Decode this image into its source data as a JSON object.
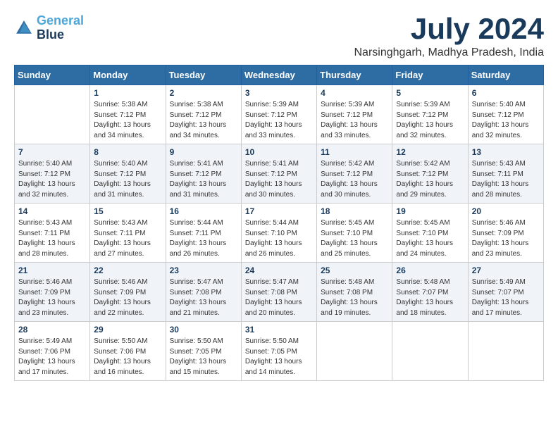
{
  "logo": {
    "line1": "General",
    "line2": "Blue"
  },
  "title": "July 2024",
  "location": "Narsinghgarh, Madhya Pradesh, India",
  "days_of_week": [
    "Sunday",
    "Monday",
    "Tuesday",
    "Wednesday",
    "Thursday",
    "Friday",
    "Saturday"
  ],
  "weeks": [
    [
      {
        "day": "",
        "sunrise": "",
        "sunset": "",
        "daylight": ""
      },
      {
        "day": "1",
        "sunrise": "Sunrise: 5:38 AM",
        "sunset": "Sunset: 7:12 PM",
        "daylight": "Daylight: 13 hours and 34 minutes."
      },
      {
        "day": "2",
        "sunrise": "Sunrise: 5:38 AM",
        "sunset": "Sunset: 7:12 PM",
        "daylight": "Daylight: 13 hours and 34 minutes."
      },
      {
        "day": "3",
        "sunrise": "Sunrise: 5:39 AM",
        "sunset": "Sunset: 7:12 PM",
        "daylight": "Daylight: 13 hours and 33 minutes."
      },
      {
        "day": "4",
        "sunrise": "Sunrise: 5:39 AM",
        "sunset": "Sunset: 7:12 PM",
        "daylight": "Daylight: 13 hours and 33 minutes."
      },
      {
        "day": "5",
        "sunrise": "Sunrise: 5:39 AM",
        "sunset": "Sunset: 7:12 PM",
        "daylight": "Daylight: 13 hours and 32 minutes."
      },
      {
        "day": "6",
        "sunrise": "Sunrise: 5:40 AM",
        "sunset": "Sunset: 7:12 PM",
        "daylight": "Daylight: 13 hours and 32 minutes."
      }
    ],
    [
      {
        "day": "7",
        "sunrise": "Sunrise: 5:40 AM",
        "sunset": "Sunset: 7:12 PM",
        "daylight": "Daylight: 13 hours and 32 minutes."
      },
      {
        "day": "8",
        "sunrise": "Sunrise: 5:40 AM",
        "sunset": "Sunset: 7:12 PM",
        "daylight": "Daylight: 13 hours and 31 minutes."
      },
      {
        "day": "9",
        "sunrise": "Sunrise: 5:41 AM",
        "sunset": "Sunset: 7:12 PM",
        "daylight": "Daylight: 13 hours and 31 minutes."
      },
      {
        "day": "10",
        "sunrise": "Sunrise: 5:41 AM",
        "sunset": "Sunset: 7:12 PM",
        "daylight": "Daylight: 13 hours and 30 minutes."
      },
      {
        "day": "11",
        "sunrise": "Sunrise: 5:42 AM",
        "sunset": "Sunset: 7:12 PM",
        "daylight": "Daylight: 13 hours and 30 minutes."
      },
      {
        "day": "12",
        "sunrise": "Sunrise: 5:42 AM",
        "sunset": "Sunset: 7:12 PM",
        "daylight": "Daylight: 13 hours and 29 minutes."
      },
      {
        "day": "13",
        "sunrise": "Sunrise: 5:43 AM",
        "sunset": "Sunset: 7:11 PM",
        "daylight": "Daylight: 13 hours and 28 minutes."
      }
    ],
    [
      {
        "day": "14",
        "sunrise": "Sunrise: 5:43 AM",
        "sunset": "Sunset: 7:11 PM",
        "daylight": "Daylight: 13 hours and 28 minutes."
      },
      {
        "day": "15",
        "sunrise": "Sunrise: 5:43 AM",
        "sunset": "Sunset: 7:11 PM",
        "daylight": "Daylight: 13 hours and 27 minutes."
      },
      {
        "day": "16",
        "sunrise": "Sunrise: 5:44 AM",
        "sunset": "Sunset: 7:11 PM",
        "daylight": "Daylight: 13 hours and 26 minutes."
      },
      {
        "day": "17",
        "sunrise": "Sunrise: 5:44 AM",
        "sunset": "Sunset: 7:10 PM",
        "daylight": "Daylight: 13 hours and 26 minutes."
      },
      {
        "day": "18",
        "sunrise": "Sunrise: 5:45 AM",
        "sunset": "Sunset: 7:10 PM",
        "daylight": "Daylight: 13 hours and 25 minutes."
      },
      {
        "day": "19",
        "sunrise": "Sunrise: 5:45 AM",
        "sunset": "Sunset: 7:10 PM",
        "daylight": "Daylight: 13 hours and 24 minutes."
      },
      {
        "day": "20",
        "sunrise": "Sunrise: 5:46 AM",
        "sunset": "Sunset: 7:09 PM",
        "daylight": "Daylight: 13 hours and 23 minutes."
      }
    ],
    [
      {
        "day": "21",
        "sunrise": "Sunrise: 5:46 AM",
        "sunset": "Sunset: 7:09 PM",
        "daylight": "Daylight: 13 hours and 23 minutes."
      },
      {
        "day": "22",
        "sunrise": "Sunrise: 5:46 AM",
        "sunset": "Sunset: 7:09 PM",
        "daylight": "Daylight: 13 hours and 22 minutes."
      },
      {
        "day": "23",
        "sunrise": "Sunrise: 5:47 AM",
        "sunset": "Sunset: 7:08 PM",
        "daylight": "Daylight: 13 hours and 21 minutes."
      },
      {
        "day": "24",
        "sunrise": "Sunrise: 5:47 AM",
        "sunset": "Sunset: 7:08 PM",
        "daylight": "Daylight: 13 hours and 20 minutes."
      },
      {
        "day": "25",
        "sunrise": "Sunrise: 5:48 AM",
        "sunset": "Sunset: 7:08 PM",
        "daylight": "Daylight: 13 hours and 19 minutes."
      },
      {
        "day": "26",
        "sunrise": "Sunrise: 5:48 AM",
        "sunset": "Sunset: 7:07 PM",
        "daylight": "Daylight: 13 hours and 18 minutes."
      },
      {
        "day": "27",
        "sunrise": "Sunrise: 5:49 AM",
        "sunset": "Sunset: 7:07 PM",
        "daylight": "Daylight: 13 hours and 17 minutes."
      }
    ],
    [
      {
        "day": "28",
        "sunrise": "Sunrise: 5:49 AM",
        "sunset": "Sunset: 7:06 PM",
        "daylight": "Daylight: 13 hours and 17 minutes."
      },
      {
        "day": "29",
        "sunrise": "Sunrise: 5:50 AM",
        "sunset": "Sunset: 7:06 PM",
        "daylight": "Daylight: 13 hours and 16 minutes."
      },
      {
        "day": "30",
        "sunrise": "Sunrise: 5:50 AM",
        "sunset": "Sunset: 7:05 PM",
        "daylight": "Daylight: 13 hours and 15 minutes."
      },
      {
        "day": "31",
        "sunrise": "Sunrise: 5:50 AM",
        "sunset": "Sunset: 7:05 PM",
        "daylight": "Daylight: 13 hours and 14 minutes."
      },
      {
        "day": "",
        "sunrise": "",
        "sunset": "",
        "daylight": ""
      },
      {
        "day": "",
        "sunrise": "",
        "sunset": "",
        "daylight": ""
      },
      {
        "day": "",
        "sunrise": "",
        "sunset": "",
        "daylight": ""
      }
    ]
  ]
}
